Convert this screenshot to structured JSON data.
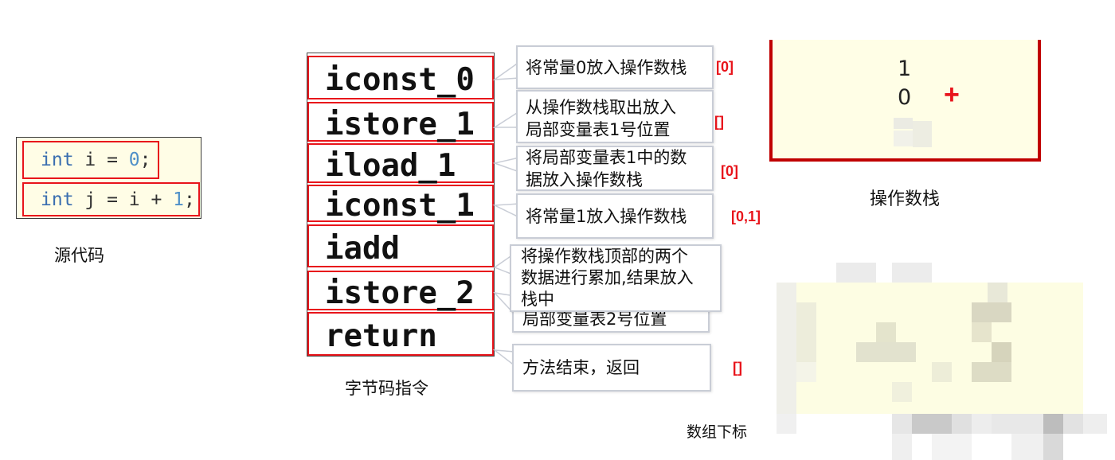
{
  "source_code": {
    "lines": [
      {
        "keyword": "int",
        "middle": " i = ",
        "number": "0",
        "end": ";"
      },
      {
        "keyword": "int",
        "middle": " j = i + ",
        "number": "1",
        "end": ";"
      }
    ],
    "caption": "源代码"
  },
  "bytecode": {
    "instructions": [
      "iconst_0",
      "istore_1",
      "iload_1",
      "iconst_1",
      "iadd",
      "istore_2",
      "return"
    ],
    "caption": "字节码指令"
  },
  "callouts": [
    {
      "lines": [
        "将常量0放入操作数栈"
      ]
    },
    {
      "lines": [
        "从操作数栈取出放入",
        "局部变量表1号位置"
      ]
    },
    {
      "lines": [
        "将局部变量表1中的数",
        "据放入操作数栈"
      ]
    },
    {
      "lines": [
        "将常量1放入操作数栈"
      ]
    },
    {
      "lines": [
        "将操作数栈顶部的两个",
        "数据进行累加,结果放入",
        "栈中"
      ]
    },
    {
      "lines": [
        "局部变量表2号位置"
      ]
    },
    {
      "lines": [
        "方法结束，返回"
      ]
    }
  ],
  "array_index_labels": [
    "[0]",
    "[]",
    "[0]",
    "[0,1]",
    "[]"
  ],
  "operand_stack": {
    "values": [
      "1",
      "0"
    ],
    "operator": "+",
    "caption": "操作数栈"
  },
  "index_caption": "数组下标",
  "colors": {
    "highlight_border": "#e8141b",
    "stack_border": "#c00000",
    "code_keyword": "#3b6fb0",
    "code_number": "#4f90c8",
    "panel_background": "#fffde6"
  }
}
